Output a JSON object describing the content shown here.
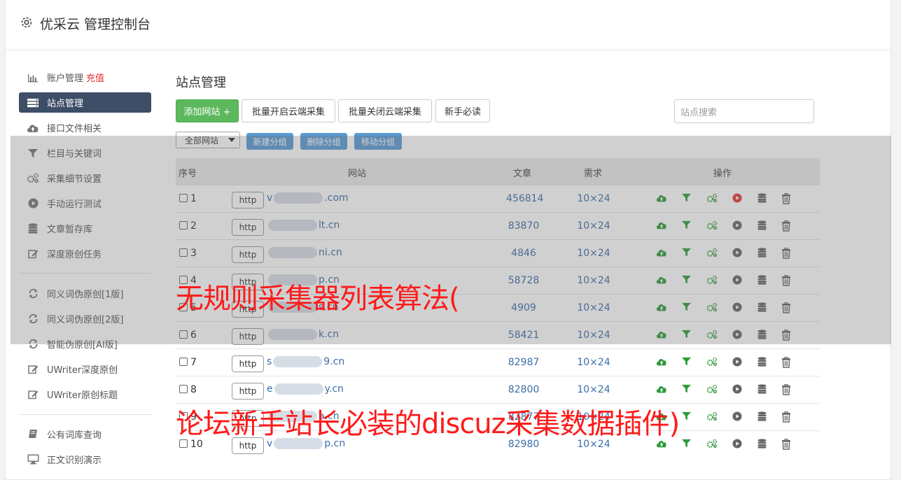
{
  "header": {
    "title": "优采云 管理控制台",
    "icon": "gear-icon"
  },
  "sidebar": {
    "items": [
      {
        "label": "账户管理",
        "extra": "充值",
        "icon": "bar-chart-icon",
        "active": false
      },
      {
        "label": "站点管理",
        "icon": "server-icon",
        "active": true
      },
      {
        "label": "接口文件相关",
        "icon": "cloud-upload-icon",
        "active": false
      },
      {
        "label": "栏目与关键词",
        "icon": "filter-icon",
        "active": false
      },
      {
        "label": "采集细节设置",
        "icon": "cogs-icon",
        "active": false
      },
      {
        "label": "手动运行测试",
        "icon": "play-circle-icon",
        "active": false
      },
      {
        "label": "文章暂存库",
        "icon": "database-icon",
        "active": false
      },
      {
        "label": "深度原创任务",
        "icon": "edit-icon",
        "active": false
      },
      {
        "label": "同义词伪原创[1版]",
        "icon": "refresh-icon",
        "active": false
      },
      {
        "label": "同义词伪原创[2版]",
        "icon": "refresh-icon",
        "active": false
      },
      {
        "label": "智能伪原创[AI版]",
        "icon": "refresh-icon",
        "active": false
      },
      {
        "label": "UWriter深度原创",
        "icon": "edit-icon",
        "active": false
      },
      {
        "label": "UWriter原创标题",
        "icon": "edit-icon",
        "active": false
      },
      {
        "label": "公有词库查询",
        "icon": "book-icon",
        "active": false
      },
      {
        "label": "正文识别演示",
        "icon": "monitor-icon",
        "active": false
      }
    ]
  },
  "main": {
    "title": "站点管理",
    "toolbar": {
      "add_site": "添加网站 +",
      "batch_open": "批量开启云端采集",
      "batch_close": "批量关闭云端采集",
      "newbie": "新手必读",
      "search_placeholder": "站点搜索"
    },
    "group": {
      "select_value": "全部网站",
      "new_group": "新建分组",
      "delete_group": "删除分组",
      "move_group": "移动分组"
    },
    "table": {
      "headers": {
        "index": "序号",
        "site": "网站",
        "articles": "文章",
        "demand": "需求",
        "ops": "操作"
      },
      "rows": [
        {
          "index": "1",
          "scheme": "http",
          "prefix": "v",
          "suffix": ".com",
          "articles": "456814",
          "demand": "10×24",
          "row_state": "running"
        },
        {
          "index": "2",
          "scheme": "http",
          "prefix": "",
          "suffix": "lt.cn",
          "articles": "83870",
          "demand": "10×24",
          "row_state": "idle"
        },
        {
          "index": "3",
          "scheme": "http",
          "prefix": "",
          "suffix": "ni.cn",
          "articles": "4846",
          "demand": "10×24",
          "row_state": "idle"
        },
        {
          "index": "4",
          "scheme": "http",
          "prefix": "",
          "suffix": "p.cn",
          "articles": "58728",
          "demand": "10×24",
          "row_state": "idle"
        },
        {
          "index": "5",
          "scheme": "http",
          "prefix": "",
          "suffix": "s.cn",
          "articles": "4909",
          "demand": "10×24",
          "row_state": "idle"
        },
        {
          "index": "6",
          "scheme": "http",
          "prefix": "",
          "suffix": "k.cn",
          "articles": "58421",
          "demand": "10×24",
          "row_state": "idle"
        },
        {
          "index": "7",
          "scheme": "http",
          "prefix": "s",
          "suffix": "9.cn",
          "articles": "82987",
          "demand": "10×24",
          "row_state": "idle"
        },
        {
          "index": "8",
          "scheme": "http",
          "prefix": "e",
          "suffix": "y.cn",
          "articles": "82800",
          "demand": "10×24",
          "row_state": "idle"
        },
        {
          "index": "9",
          "scheme": "http",
          "prefix": "",
          "suffix": "a.cn",
          "articles": "82877",
          "demand": "10×24",
          "row_state": "idle"
        },
        {
          "index": "10",
          "scheme": "http",
          "prefix": "v",
          "suffix": "p.cn",
          "articles": "82980",
          "demand": "10×24",
          "row_state": "idle"
        }
      ]
    }
  },
  "overlay_captions": {
    "line1": "无规则采集器列表算法(",
    "line2": "论坛新手站长必装的discuz采集数据插件)"
  },
  "colors": {
    "accent_green": "#5cb85c",
    "sidebar_active": "#3d4e66",
    "link_blue": "#3a6ea8",
    "caption_red": "#ff1a1a",
    "run_red": "#e53935",
    "icon_green": "#2e9a3a"
  }
}
